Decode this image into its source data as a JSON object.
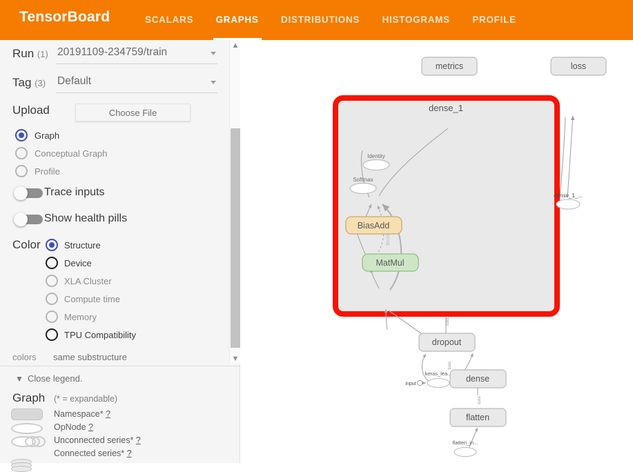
{
  "header": {
    "brand": "TensorBoard",
    "tabs": [
      {
        "label": "SCALARS",
        "active": false
      },
      {
        "label": "GRAPHS",
        "active": true
      },
      {
        "label": "DISTRIBUTIONS",
        "active": false
      },
      {
        "label": "HISTOGRAMS",
        "active": false
      },
      {
        "label": "PROFILE",
        "active": false
      }
    ],
    "accent_color": "#f57c00"
  },
  "sidebar": {
    "run": {
      "label": "Run",
      "count": "(1)",
      "value": "20191109-234759/train"
    },
    "tag": {
      "label": "Tag",
      "count": "(3)",
      "value": "Default"
    },
    "upload": {
      "label": "Upload",
      "button": "Choose File"
    },
    "graph_type": [
      {
        "label": "Graph",
        "state": "selected"
      },
      {
        "label": "Conceptual Graph",
        "state": "off"
      },
      {
        "label": "Profile",
        "state": "off"
      }
    ],
    "toggles": [
      {
        "label": "Trace inputs",
        "on": false
      },
      {
        "label": "Show health pills",
        "on": false
      }
    ],
    "color": {
      "label": "Color",
      "options": [
        {
          "label": "Structure",
          "state": "selected"
        },
        {
          "label": "Device",
          "state": "dark"
        },
        {
          "label": "XLA Cluster",
          "state": "off"
        },
        {
          "label": "Compute time",
          "state": "off"
        },
        {
          "label": "Memory",
          "state": "off"
        },
        {
          "label": "TPU Compatibility",
          "state": "dark"
        }
      ]
    },
    "colors_row": {
      "key": "colors",
      "value": "same substructure"
    }
  },
  "legend": {
    "close_label": "Close legend.",
    "title": "Graph",
    "note": "(* = expandable)",
    "items": [
      {
        "label": "Namespace*",
        "help": "?",
        "glyph": "namespace-swatch"
      },
      {
        "label": "OpNode",
        "help": "?",
        "glyph": "opnode-swatch"
      },
      {
        "label": "Unconnected series*",
        "help": "?",
        "glyph": "unconnected-series-swatch"
      },
      {
        "label": "Connected series*",
        "help": "?",
        "glyph": "connected-series-swatch"
      }
    ]
  },
  "graph": {
    "highlight_color": "#f81303",
    "namespace_fill": "#e9e9e9",
    "namespace_stroke": "#b9b9b9",
    "selected_namespace": "dense_1",
    "nodes": [
      {
        "id": "metrics",
        "label": "metrics",
        "shape": "namespace"
      },
      {
        "id": "loss",
        "label": "loss",
        "shape": "namespace"
      },
      {
        "id": "dense_1",
        "label": "dense_1",
        "shape": "namespace-expanded",
        "highlighted": true
      },
      {
        "id": "identity",
        "label": "Identity",
        "shape": "opnode"
      },
      {
        "id": "softmax",
        "label": "Softmax",
        "shape": "opnode"
      },
      {
        "id": "biasadd",
        "label": "BiasAdd",
        "shape": "op-rounded",
        "fill": "#f7dfb1",
        "stroke": "#c9a86b"
      },
      {
        "id": "matmul",
        "label": "MatMul",
        "shape": "op-rounded",
        "fill": "#cfe6c6",
        "stroke": "#8fbd86"
      },
      {
        "id": "dense_1_ref",
        "label": "dense_1_...",
        "shape": "opnode"
      },
      {
        "id": "dropout",
        "label": "dropout",
        "shape": "namespace"
      },
      {
        "id": "dense",
        "label": "dense",
        "shape": "namespace"
      },
      {
        "id": "flatten",
        "label": "flatten",
        "shape": "namespace"
      },
      {
        "id": "keras_lea",
        "label": "keras_lea...",
        "shape": "opnode"
      },
      {
        "id": "input",
        "label": "input",
        "shape": "input-port"
      },
      {
        "id": "flatten_in",
        "label": "flatten_in...",
        "shape": "opnode"
      }
    ],
    "edge_labels": [
      "32x10",
      "32x10",
      "data",
      "data",
      "data"
    ]
  }
}
